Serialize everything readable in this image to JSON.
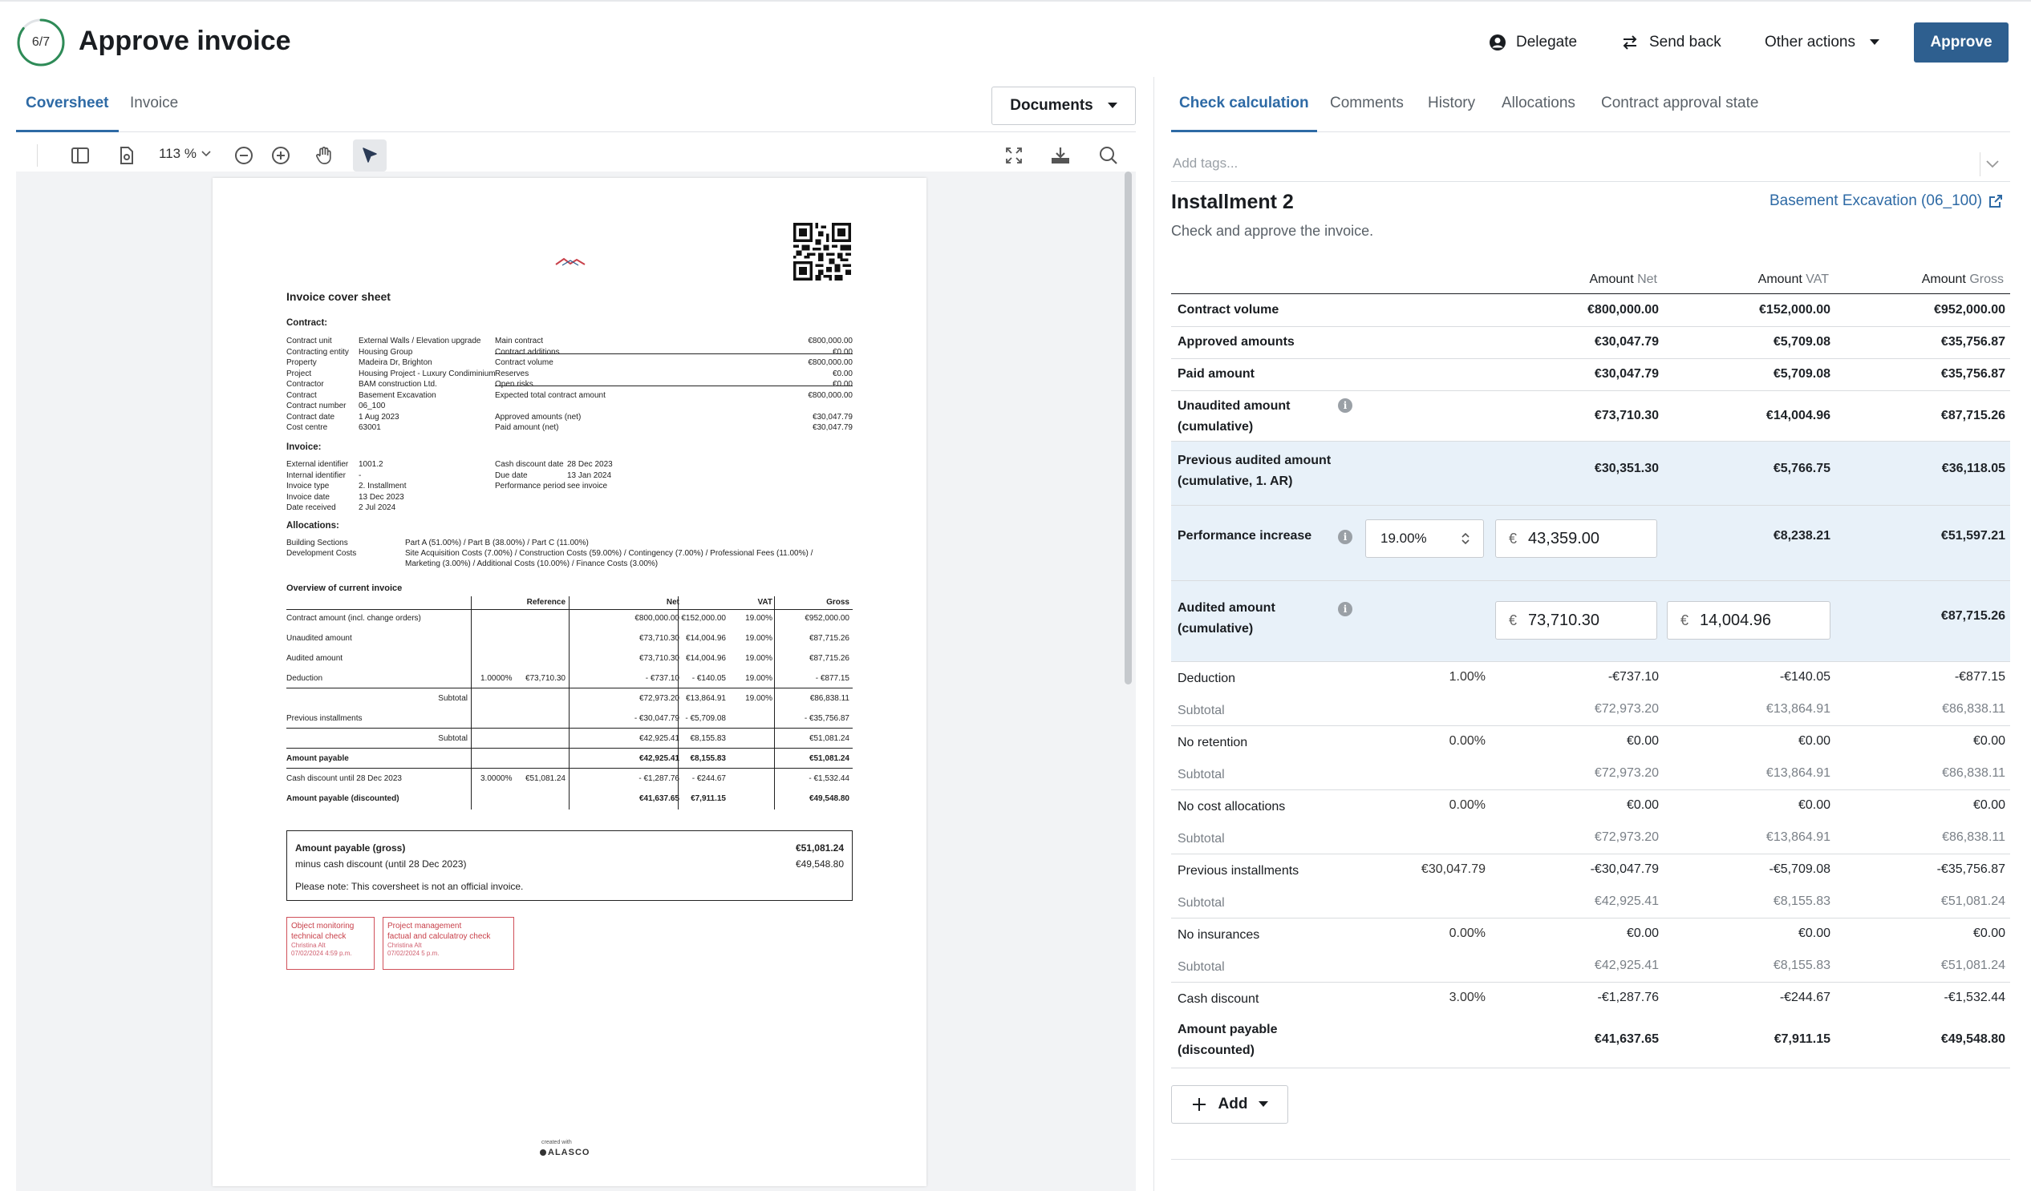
{
  "header": {
    "progress": "6/7",
    "progress_fraction": 0.857,
    "title": "Approve invoice",
    "delegate_label": "Delegate",
    "send_back_label": "Send back",
    "other_actions_label": "Other actions",
    "approve_label": "Approve"
  },
  "colors": {
    "accent": "#2e6aa5",
    "approve": "#2e5f8f",
    "highlight_row": "#e8f1f9",
    "stamp": "#c8404a"
  },
  "left_tabs": [
    "Coversheet",
    "Invoice"
  ],
  "documents_label": "Documents",
  "viewer": {
    "zoom": "113 %"
  },
  "doc": {
    "title": "Invoice cover sheet",
    "contract_heading": "Contract:",
    "contract_left": [
      [
        "Contract unit",
        "External Walls / Elevation upgrade"
      ],
      [
        "Contracting entity",
        "Housing Group"
      ],
      [
        "Property",
        "Madeira Dr, Brighton"
      ],
      [
        "Project",
        "Housing Project - Luxury Condiminium"
      ],
      [
        "Contractor",
        "BAM construction Ltd."
      ],
      [
        "Contract",
        "Basement Excavation"
      ],
      [
        "Contract number",
        "06_100"
      ],
      [
        "Contract date",
        "1 Aug 2023"
      ],
      [
        "Cost centre",
        "63001"
      ]
    ],
    "contract_right": [
      [
        "Main contract",
        "€800,000.00"
      ],
      [
        "Contract additions",
        "€0.00"
      ],
      [
        "Contract volume",
        "€800,000.00"
      ],
      [
        "Reserves",
        "€0.00"
      ],
      [
        "Open risks",
        "€0.00"
      ],
      [
        "Expected total contract amount",
        "€800,000.00"
      ],
      [
        "",
        ""
      ],
      [
        "Approved amounts (net)",
        "€30,047.79"
      ],
      [
        "Paid amount (net)",
        "€30,047.79"
      ]
    ],
    "invoice_heading": "Invoice:",
    "invoice_left": [
      [
        "External identifier",
        "1001.2"
      ],
      [
        "Internal identifier",
        "-"
      ],
      [
        "Invoice type",
        "2. Installment"
      ],
      [
        "Invoice date",
        "13 Dec 2023"
      ],
      [
        "Date received",
        "2 Jul 2024"
      ]
    ],
    "invoice_right": [
      [
        "Cash discount date",
        "28 Dec 2023"
      ],
      [
        "Due date",
        "13 Jan 2024"
      ],
      [
        "Performance period",
        "see invoice"
      ]
    ],
    "allocations_heading": "Allocations:",
    "alloc_building_label": "Building Sections",
    "alloc_building": "Part A (51.00%) / Part B (38.00%) / Part C (11.00%)",
    "alloc_dev_label": "Development Costs",
    "alloc_dev_1": "Site Acquisition Costs (7.00%) / Construction Costs (59.00%) / Contingency (7.00%) / Professional Fees (11.00%) /",
    "alloc_dev_2": "Marketing (3.00%) / Additional Costs (10.00%) / Finance Costs (3.00%)",
    "overview_heading": "Overview of current invoice",
    "ov_headers": {
      "ref": "Reference",
      "net": "Net",
      "vat": "VAT",
      "gross": "Gross"
    },
    "ov_rows": [
      {
        "label": "Contract amount (incl. change orders)",
        "r1": "",
        "r2": "",
        "net": "€800,000.00",
        "vatamt": "€152,000.00",
        "vatpct": "19.00%",
        "gross": "€952,000.00",
        "bold": false
      },
      {
        "label": "Unaudited amount",
        "r1": "",
        "r2": "",
        "net": "€73,710.30",
        "vatamt": "€14,004.96",
        "vatpct": "19.00%",
        "gross": "€87,715.26",
        "bold": false
      },
      {
        "label": "Audited amount",
        "r1": "",
        "r2": "",
        "net": "€73,710.30",
        "vatamt": "€14,004.96",
        "vatpct": "19.00%",
        "gross": "€87,715.26",
        "bold": false
      },
      {
        "label": "Deduction",
        "r1": "1.0000%",
        "r2": "€73,710.30",
        "net": "- €737.10",
        "vatamt": "- €140.05",
        "vatpct": "19.00%",
        "gross": "- €877.15",
        "bold": false
      },
      {
        "label": "Subtotal",
        "r1": "",
        "r2": "",
        "net": "€72,973.20",
        "vatamt": "€13,864.91",
        "vatpct": "19.00%",
        "gross": "€86,838.11",
        "bold": false,
        "sub": true
      },
      {
        "label": "Previous installments",
        "r1": "",
        "r2": "",
        "net": "- €30,047.79",
        "vatamt": "- €5,709.08",
        "vatpct": "",
        "gross": "- €35,756.87",
        "bold": false
      },
      {
        "label": "Subtotal",
        "r1": "",
        "r2": "",
        "net": "€42,925.41",
        "vatamt": "€8,155.83",
        "vatpct": "",
        "gross": "€51,081.24",
        "bold": false,
        "sub": true
      },
      {
        "label": "Amount payable",
        "r1": "",
        "r2": "",
        "net": "€42,925.41",
        "vatamt": "€8,155.83",
        "vatpct": "",
        "gross": "€51,081.24",
        "bold": true
      },
      {
        "label": "Cash discount until 28 Dec 2023",
        "r1": "3.0000%",
        "r2": "€51,081.24",
        "net": "- €1,287.76",
        "vatamt": "- €244.67",
        "vatpct": "",
        "gross": "- €1,532.44",
        "bold": false
      },
      {
        "label": "Amount payable (discounted)",
        "r1": "",
        "r2": "",
        "net": "€41,637.65",
        "vatamt": "€7,911.15",
        "vatpct": "",
        "gross": "€49,548.80",
        "bold": true
      }
    ],
    "box_gross_label": "Amount payable (gross)",
    "box_gross_value": "€51,081.24",
    "box_discount_label": "minus cash discount (until 28 Dec 2023)",
    "box_discount_value": "€49,548.80",
    "box_note": "Please note: This coversheet is not an official invoice.",
    "stamp1": {
      "l1": "Object monitoring",
      "l2": "technical check",
      "name": "Christina Alt",
      "date": "07/02/2024 4:59 p.m."
    },
    "stamp2": {
      "l1": "Project management",
      "l2": "factual and calculatroy check",
      "name": "Christina Alt",
      "date": "07/02/2024 5 p.m."
    },
    "footer_small": "created with",
    "footer_brand": "ALASCO"
  },
  "right_tabs": [
    "Check calculation",
    "Comments",
    "History",
    "Allocations",
    "Contract approval state"
  ],
  "tags_placeholder": "Add tags...",
  "installment": {
    "title": "Installment 2",
    "subtitle": "Check and approve the invoice.",
    "contract_link": "Basement Excavation (06_100)"
  },
  "columns": {
    "net": {
      "a": "Amount",
      "b": "Net"
    },
    "vat": {
      "a": "Amount",
      "b": "VAT"
    },
    "gross": {
      "a": "Amount",
      "b": "Gross"
    }
  },
  "calc": {
    "contract_volume": {
      "label": "Contract volume",
      "net": "€800,000.00",
      "vat": "€152,000.00",
      "gross": "€952,000.00"
    },
    "approved": {
      "label": "Approved amounts",
      "net": "€30,047.79",
      "vat": "€5,709.08",
      "gross": "€35,756.87"
    },
    "paid": {
      "label": "Paid amount",
      "net": "€30,047.79",
      "vat": "€5,709.08",
      "gross": "€35,756.87"
    },
    "unaudited": {
      "label1": "Unaudited amount",
      "label2": "(cumulative)",
      "net": "€73,710.30",
      "vat": "€14,004.96",
      "gross": "€87,715.26"
    },
    "prev_audited": {
      "label1": "Previous audited amount",
      "label2": "(cumulative, 1. AR)",
      "net": "€30,351.30",
      "vat": "€5,766.75",
      "gross": "€36,118.05"
    },
    "perf_increase": {
      "label": "Performance increase",
      "pct": "19.00%",
      "net_input": "43,359.00",
      "currency": "€",
      "vat": "€8,238.21",
      "gross": "€51,597.21"
    },
    "audited": {
      "label1": "Audited amount",
      "label2": "(cumulative)",
      "net_input": "73,710.30",
      "vat_input": "14,004.96",
      "currency": "€",
      "gross": "€87,715.26"
    },
    "lines": [
      {
        "label": "Deduction",
        "pct": "1.00%",
        "net": "-€737.10",
        "vat": "-€140.05",
        "gross": "-€877.15"
      },
      {
        "label": "Subtotal",
        "pct": "",
        "net": "€72,973.20",
        "vat": "€13,864.91",
        "gross": "€86,838.11",
        "sub": true
      },
      {
        "label": "No retention",
        "pct": "0.00%",
        "net": "€0.00",
        "vat": "€0.00",
        "gross": "€0.00"
      },
      {
        "label": "Subtotal",
        "pct": "",
        "net": "€72,973.20",
        "vat": "€13,864.91",
        "gross": "€86,838.11",
        "sub": true
      },
      {
        "label": "No cost allocations",
        "pct": "0.00%",
        "net": "€0.00",
        "vat": "€0.00",
        "gross": "€0.00"
      },
      {
        "label": "Subtotal",
        "pct": "",
        "net": "€72,973.20",
        "vat": "€13,864.91",
        "gross": "€86,838.11",
        "sub": true
      },
      {
        "label": "Previous installments",
        "pct": "€30,047.79",
        "net": "-€30,047.79",
        "vat": "-€5,709.08",
        "gross": "-€35,756.87"
      },
      {
        "label": "Subtotal",
        "pct": "",
        "net": "€42,925.41",
        "vat": "€8,155.83",
        "gross": "€51,081.24",
        "sub": true
      },
      {
        "label": "No insurances",
        "pct": "0.00%",
        "net": "€0.00",
        "vat": "€0.00",
        "gross": "€0.00"
      },
      {
        "label": "Subtotal",
        "pct": "",
        "net": "€42,925.41",
        "vat": "€8,155.83",
        "gross": "€51,081.24",
        "sub": true
      },
      {
        "label": "Cash discount",
        "pct": "3.00%",
        "net": "-€1,287.76",
        "vat": "-€244.67",
        "gross": "-€1,532.44"
      }
    ],
    "payable": {
      "label1": "Amount payable",
      "label2": "(discounted)",
      "net": "€41,637.65",
      "vat": "€7,911.15",
      "gross": "€49,548.80"
    }
  },
  "add_label": "Add"
}
